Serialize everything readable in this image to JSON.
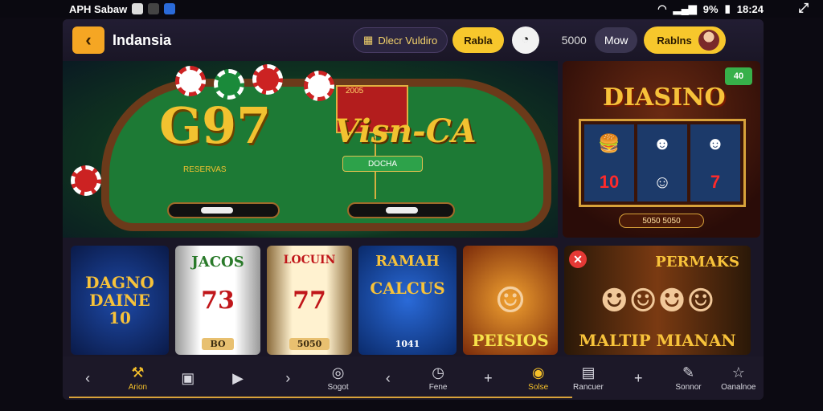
{
  "status_bar": {
    "app_label": "APH Sabaw",
    "time": "18:24",
    "battery": "9%"
  },
  "header": {
    "title": "Indansia",
    "promo_text": "Dlecr Vuldiro",
    "yellow_button": "Rabla",
    "balance": "5000",
    "grey_button": "Mow",
    "profile_button": "Rablns"
  },
  "hero": {
    "left_title": "G97",
    "left_small": "RESERVAS",
    "right_card_label": "2005",
    "right_title": "Visn-CA",
    "right_pill": "DOCHA"
  },
  "slot_panel": {
    "title": "DIASINO",
    "badge": "40",
    "footer": "5050 5050",
    "reel_numbers": [
      "10",
      "7"
    ]
  },
  "tiles": [
    {
      "line1": "DAGNO",
      "line2": "DAINE",
      "line3": "10"
    },
    {
      "line1": "JACOS",
      "line2": "73",
      "sub": "BO"
    },
    {
      "line1": "LOCUIN",
      "line2": "77",
      "sub": "5050"
    },
    {
      "line1": "RAMAH",
      "line2": "CALCUS",
      "sub": "1041"
    },
    {
      "line1": "PEISIOS"
    },
    {
      "line1": "PERMAKS",
      "line2": "MALTIP MIANAN"
    }
  ],
  "bottom_nav": [
    {
      "icon": "chevron-left-icon",
      "glyph": "‹",
      "label": ""
    },
    {
      "icon": "tools-icon",
      "glyph": "⚒",
      "label": "Arion",
      "active": true
    },
    {
      "icon": "wallet-icon",
      "glyph": "▣",
      "label": ""
    },
    {
      "icon": "play-icon",
      "glyph": "▶",
      "label": ""
    },
    {
      "icon": "chevron-right-icon",
      "glyph": "›",
      "label": ""
    },
    {
      "icon": "target-icon",
      "glyph": "◎",
      "label": "Sogot"
    },
    {
      "icon": "chevron-left-icon",
      "glyph": "‹",
      "label": ""
    },
    {
      "icon": "clock-icon",
      "glyph": "◷",
      "label": "Fene"
    },
    {
      "icon": "plus-icon",
      "glyph": "+",
      "label": ""
    },
    {
      "icon": "coin-icon",
      "glyph": "◉",
      "label": "Solse",
      "active": true
    },
    {
      "icon": "box-icon",
      "glyph": "▤",
      "label": "Rancuer"
    },
    {
      "icon": "plus-icon",
      "glyph": "+",
      "label": ""
    },
    {
      "icon": "edit-icon",
      "glyph": "✎",
      "label": "Sonnor"
    },
    {
      "icon": "star-icon",
      "glyph": "☆",
      "label": "Oanalnoe"
    }
  ]
}
